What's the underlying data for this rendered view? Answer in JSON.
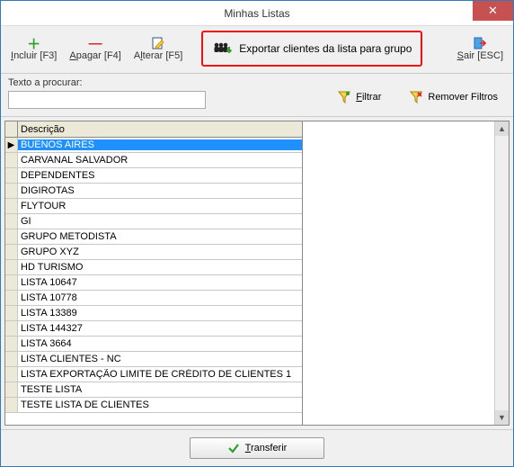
{
  "window": {
    "title": "Minhas Listas"
  },
  "toolbar": {
    "incluir_label": "Incluir [F3]",
    "apagar_label": "Apagar [F4]",
    "alterar_label": "Alterar [F5]",
    "export_label": "Exportar clientes da lista para grupo",
    "sair_label": "Sair [ESC]"
  },
  "search": {
    "label": "Texto a procurar:",
    "value": ""
  },
  "filters": {
    "filtrar_label": "Filtrar",
    "remover_label": "Remover Filtros"
  },
  "grid": {
    "header": "Descrição",
    "selected_index": 0,
    "rows": [
      "BUENOS AIRES",
      "CARVANAL SALVADOR",
      "DEPENDENTES",
      "DIGIROTAS",
      "FLYTOUR",
      "GI",
      "GRUPO METODISTA",
      "GRUPO XYZ",
      "HD TURISMO",
      "LISTA 10647",
      "LISTA 10778",
      "LISTA 13389",
      "LISTA 144327",
      "LISTA 3664",
      "LISTA CLIENTES - NC",
      "LISTA EXPORTAÇÃO LIMITE DE CRÉDITO DE CLIENTES 1",
      "TESTE LISTA",
      "TESTE LISTA DE CLIENTES"
    ]
  },
  "footer": {
    "transferir_label": "Transferir"
  }
}
